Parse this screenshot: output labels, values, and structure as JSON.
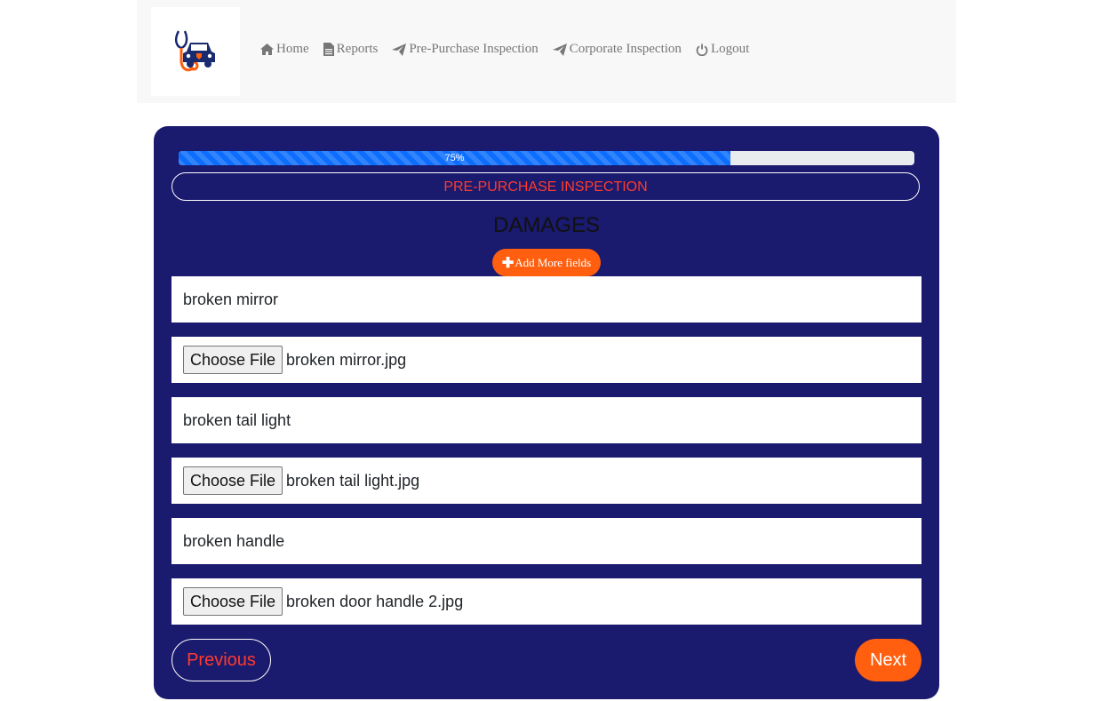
{
  "nav": {
    "home": "Home",
    "reports": "Reports",
    "pre_purchase": "Pre-Purchase Inspection",
    "corporate": "Corporate Inspection",
    "logout": "Logout"
  },
  "progress": {
    "label": "75%",
    "value": 0.75
  },
  "form": {
    "title": "PRE-PURCHASE INSPECTION",
    "section": "DAMAGES",
    "add_label": "Add More fields",
    "choose_label": "Choose File",
    "damages": [
      {
        "description": "broken mirror",
        "file": "broken mirror.jpg"
      },
      {
        "description": "broken tail light",
        "file": "broken tail light.jpg"
      },
      {
        "description": "broken handle",
        "file": "broken door handle 2.jpg"
      }
    ],
    "previous": "Previous",
    "next": "Next"
  },
  "colors": {
    "card_bg": "#1a1a6e",
    "accent": "#ff5f0f",
    "title_red": "#ff3b2f",
    "progress_blue": "#0d6efd"
  }
}
